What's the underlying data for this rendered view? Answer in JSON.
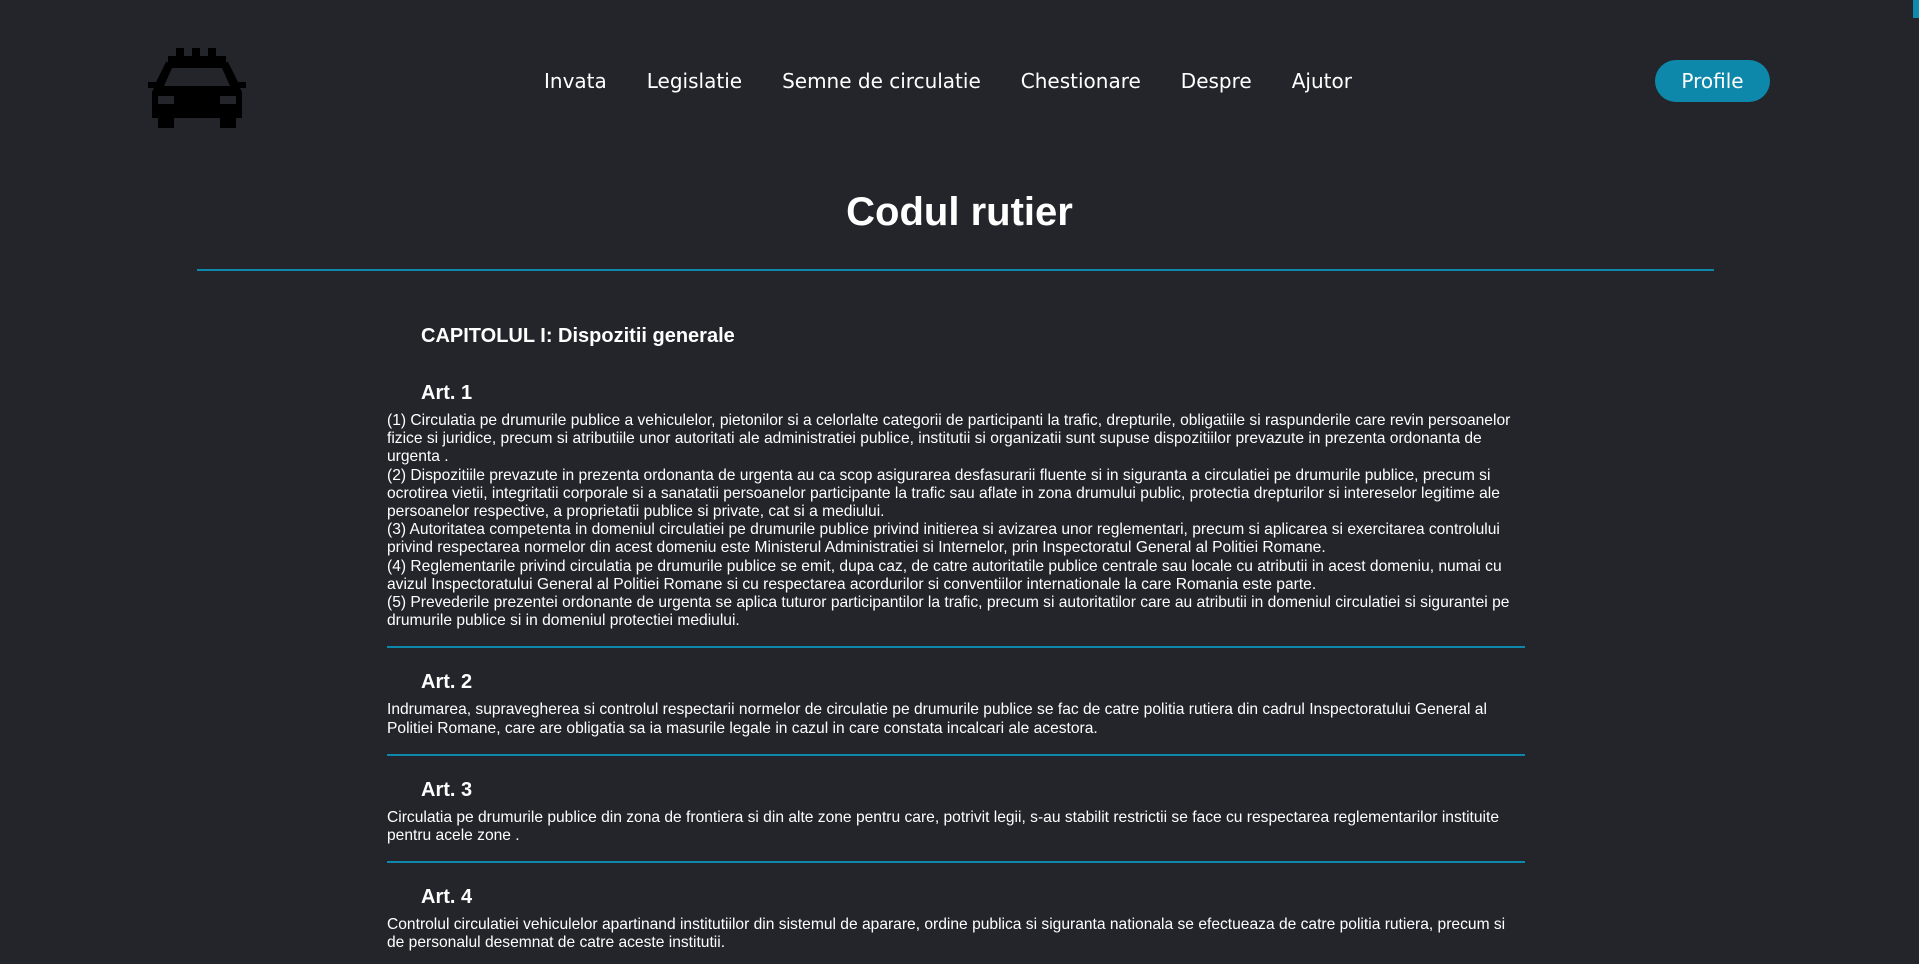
{
  "header": {
    "logo_icon": "taxi-car-icon",
    "nav": [
      {
        "label": "Invata"
      },
      {
        "label": "Legislatie"
      },
      {
        "label": "Semne de circulatie"
      },
      {
        "label": "Chestionare"
      },
      {
        "label": "Despre"
      },
      {
        "label": "Ajutor"
      }
    ],
    "profile_label": "Profile"
  },
  "colors": {
    "background": "#23252b",
    "accent": "#0e88aa",
    "text": "#ffffff"
  },
  "main": {
    "title": "Codul rutier",
    "chapter": "CAPITOLUL I: Dispozitii generale",
    "articles": [
      {
        "title": "Art. 1",
        "paragraphs": [
          "(1) Circulatia pe drumurile publice a vehiculelor, pietonilor si a celorlalte categorii de participanti la trafic, drepturile, obligatiile si raspunderile care revin persoanelor fizice si juridice, precum si atributiile unor autoritati ale administratiei publice, institutii si organizatii sunt supuse dispozitiilor prevazute in prezenta ordonanta de urgenta .",
          "(2) Dispozitiile prevazute in prezenta ordonanta de urgenta au ca scop asigurarea desfasurarii fluente si in siguranta a circulatiei pe drumurile publice, precum si ocrotirea vietii, integritatii corporale si a sanatatii persoanelor participante la trafic sau aflate in zona drumului public, protectia drepturilor si intereselor legitime ale persoanelor respective, a proprietatii publice si private, cat si a mediului.",
          "(3) Autoritatea competenta in domeniul circulatiei pe drumurile publice privind initierea si avizarea unor reglementari, precum si aplicarea si exercitarea controlului privind respectarea normelor din acest domeniu este Ministerul Administratiei si Internelor, prin Inspectoratul General al Politiei Romane.",
          "(4) Reglementarile privind circulatia pe drumurile publice se emit, dupa caz, de catre autoritatile publice centrale sau locale cu atributii in acest domeniu, numai cu avizul Inspectoratului General al Politiei Romane si cu respectarea acordurilor si conventiilor internationale la care Romania este parte.",
          "(5) Prevederile prezentei ordonante de urgenta se aplica tuturor participantilor la trafic, precum si autoritatilor care au atributii in domeniul circulatiei si sigurantei pe drumurile publice si in domeniul protectiei mediului."
        ]
      },
      {
        "title": "Art. 2",
        "paragraphs": [
          "Indrumarea, supravegherea si controlul respectarii normelor de circulatie pe drumurile publice se fac de catre politia rutiera din cadrul Inspectoratului General al Politiei Romane, care are obligatia sa ia masurile legale in cazul in care constata incalcari ale acestora."
        ]
      },
      {
        "title": "Art. 3",
        "paragraphs": [
          "Circulatia pe drumurile publice din zona de frontiera si din alte zone pentru care, potrivit legii, s-au stabilit restrictii se face cu respectarea reglementarilor instituite pentru acele zone ."
        ]
      },
      {
        "title": "Art. 4",
        "paragraphs": [
          "Controlul circulatiei vehiculelor apartinand institutiilor din sistemul de aparare, ordine publica si siguranta nationala se efectueaza de catre politia rutiera, precum si de personalul desemnat de catre aceste institutii."
        ]
      }
    ]
  }
}
